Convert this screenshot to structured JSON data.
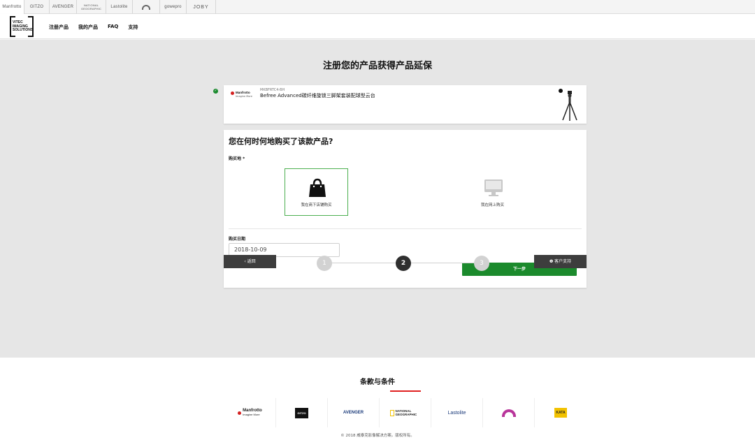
{
  "brand_strip": {
    "tabs": [
      "Manfrotto",
      "GITZO",
      "AVENGER",
      "NATIONAL GEOGRAPHIC",
      "Lastolite",
      "",
      "gowepro",
      "JOBY"
    ]
  },
  "header": {
    "logo_text": [
      "VITEC",
      "IMAGING",
      "SOLUTIONS"
    ],
    "nav": [
      "注册产品",
      "我的产品",
      "FAQ",
      "支持"
    ]
  },
  "main": {
    "title": "注册您的产品获得产品延保",
    "product": {
      "brand": "Manfrotto",
      "brand_tagline": "Imagine More",
      "sku": "MKBFRTC4-BH",
      "name": "Befree Advanced碳纤维旋锁三脚架套装配球型云台"
    },
    "form": {
      "question": "您在何时何地购买了该款产品?",
      "place_label": "购买地 *",
      "options": [
        {
          "label": "我在商下店铺购买",
          "icon": "shopping-bag-icon"
        },
        {
          "label": "我在网上购买",
          "icon": "monitor-icon"
        }
      ],
      "date_label": "购买日期",
      "date_value": "2018-10-09",
      "next_label": "下一步"
    },
    "stepper": {
      "back_label": "‹ 返回",
      "support_label": "❶ 客户支持",
      "steps": [
        "1",
        "2",
        "3"
      ],
      "active_step": 2
    }
  },
  "footer": {
    "terms": "条款与条件",
    "logos": [
      "Manfrotto",
      "GITZO",
      "AVENGER",
      "NATIONAL GEOGRAPHIC",
      "Lastolite",
      "",
      "KATA"
    ],
    "manfrotto_tagline": "Imagine More",
    "copyright": "© 2018 威泰克影像解决方案。版权所有。"
  },
  "colors": {
    "accent_green": "#1b8a2c",
    "dark_button": "#3d3d3d",
    "terms_red": "#e02020",
    "background_gray": "#e6e6e6"
  }
}
